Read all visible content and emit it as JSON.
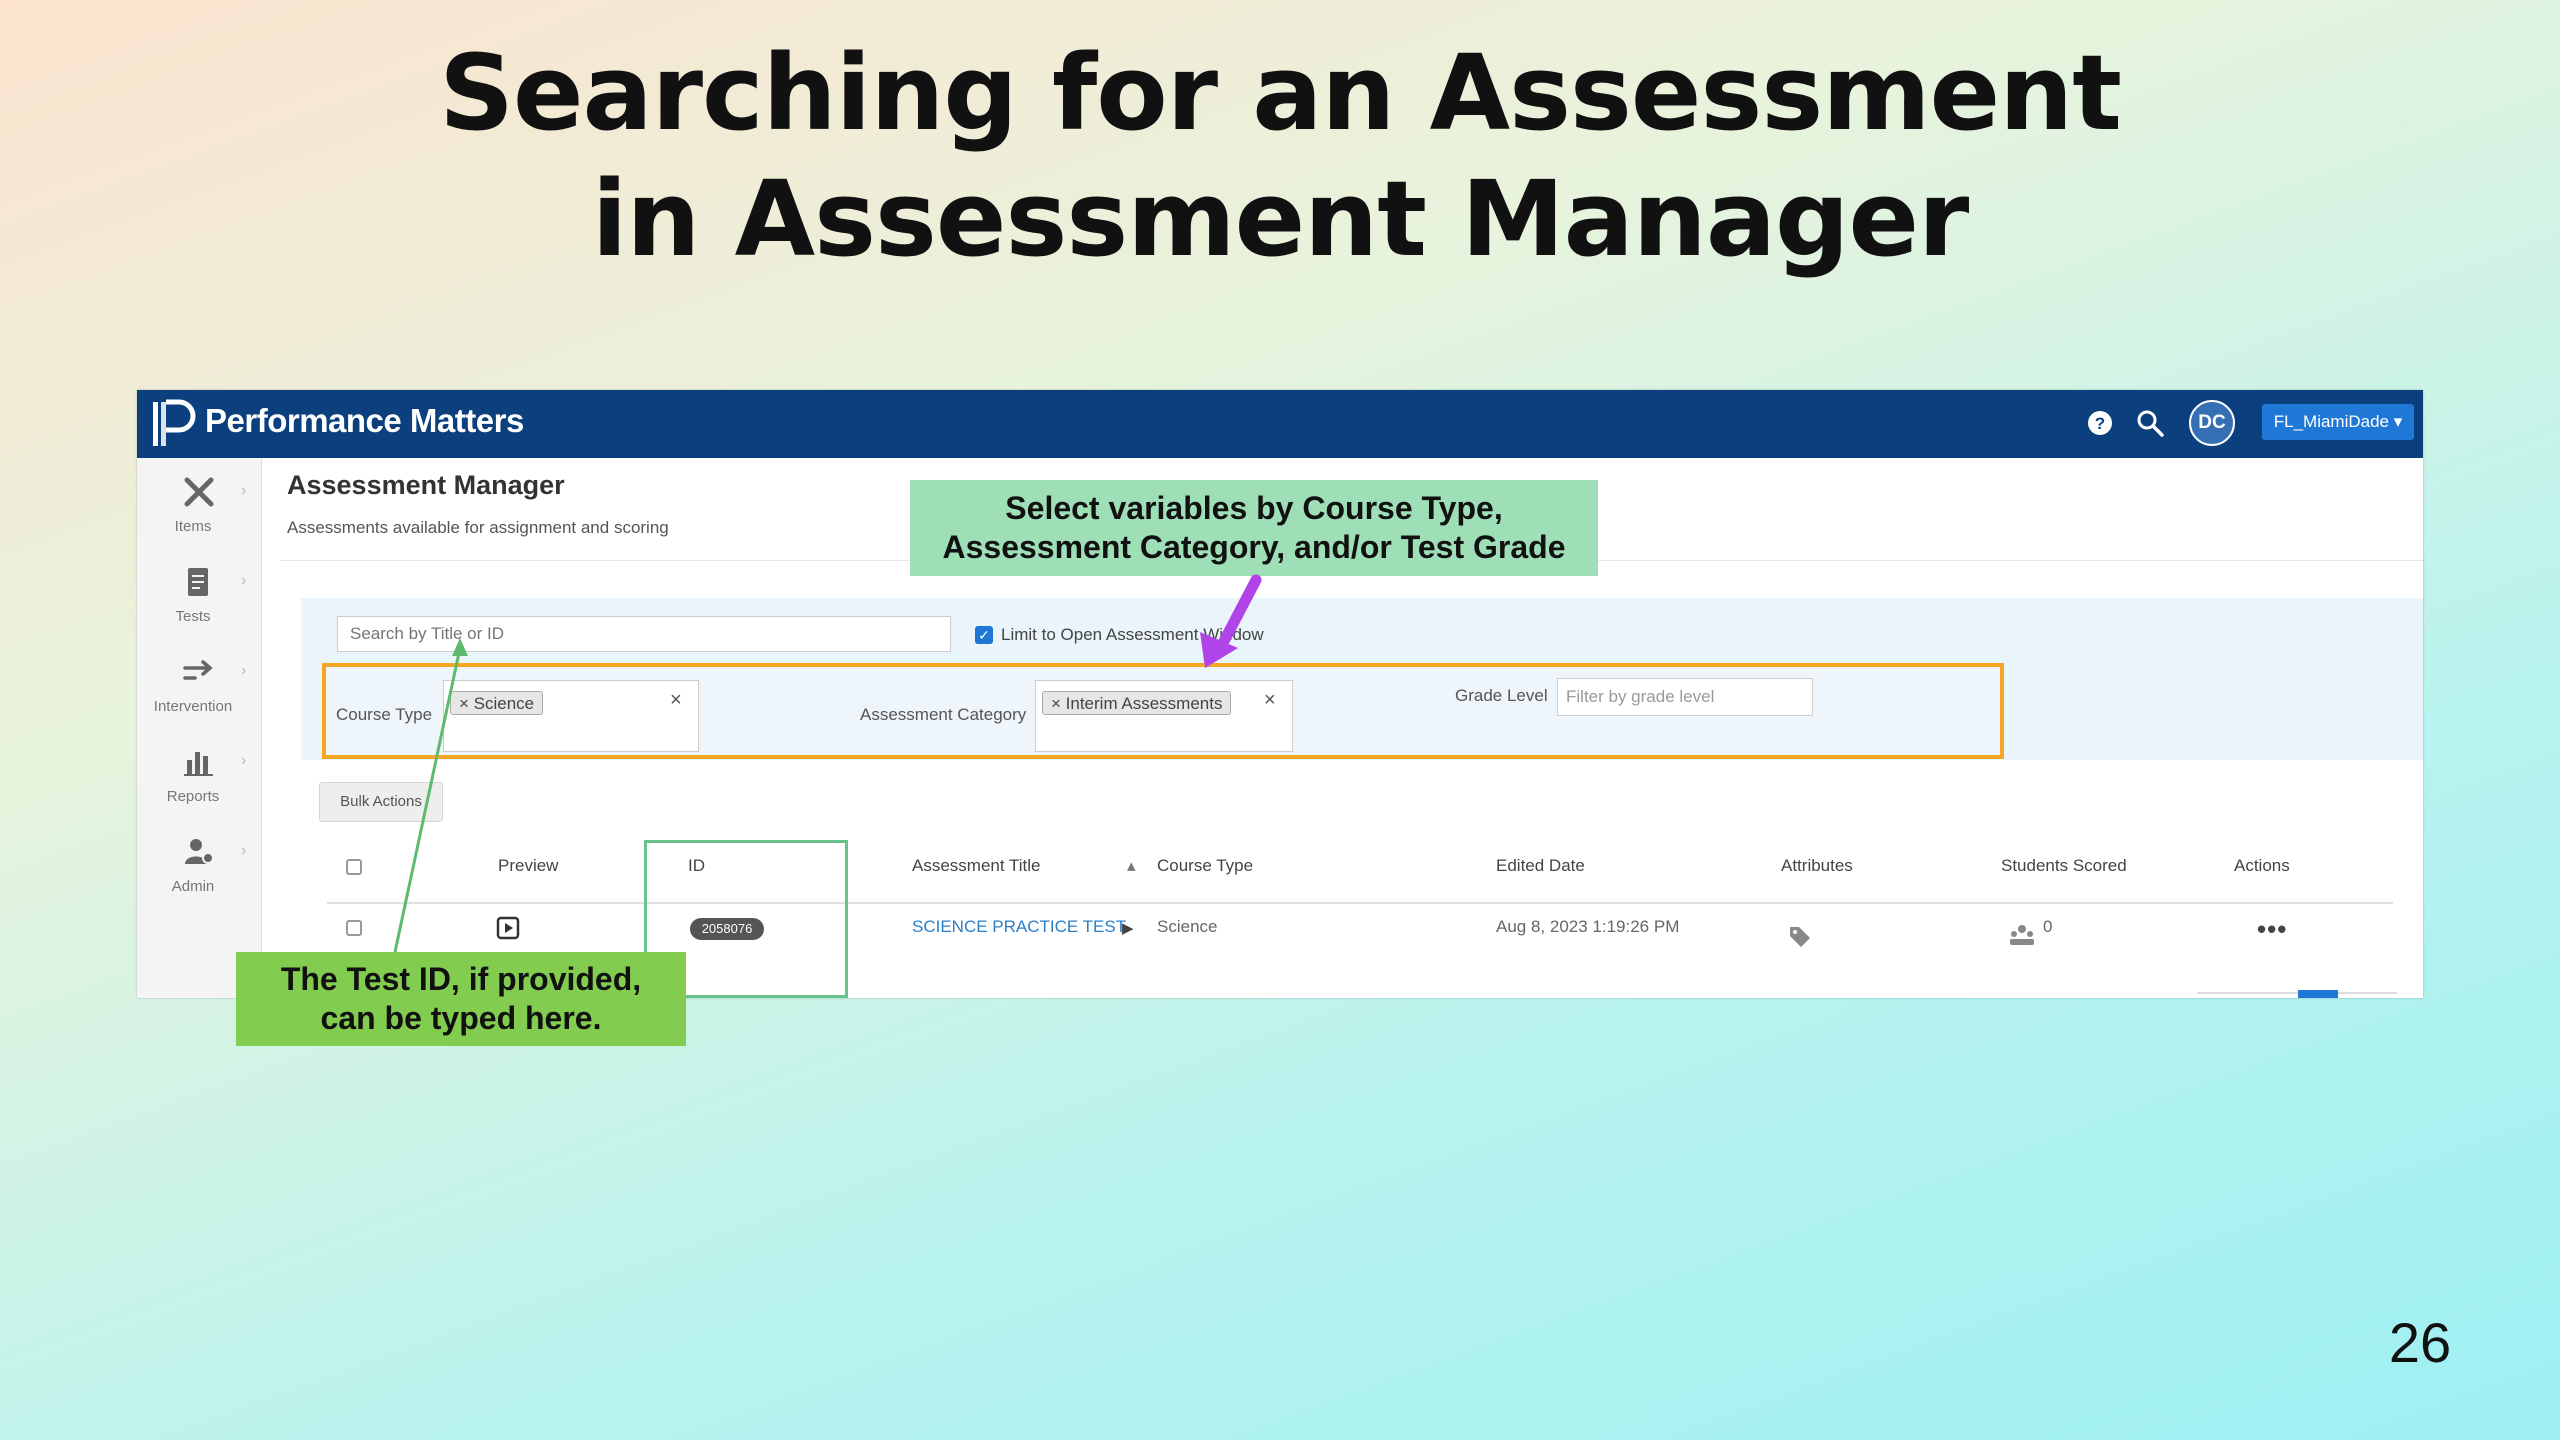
{
  "slide": {
    "title_line1": "Searching for an Assessment",
    "title_line2": "in Assessment Manager",
    "page_number": "26"
  },
  "callouts": {
    "variables_line1": "Select variables by Course Type,",
    "variables_line2": "Assessment Category, and/or Test Grade",
    "test_id_line1": "The Test ID, if provided,",
    "test_id_line2": "can be typed here."
  },
  "app": {
    "brand": "Performance Matters",
    "avatar_initials": "DC",
    "district_button": "FL_MiamiDade ▾",
    "sidebar": [
      {
        "label": "Items",
        "icon": "items-icon"
      },
      {
        "label": "Tests",
        "icon": "tests-icon"
      },
      {
        "label": "Intervention",
        "icon": "intervention-icon"
      },
      {
        "label": "Reports",
        "icon": "reports-icon"
      },
      {
        "label": "Admin",
        "icon": "admin-icon"
      }
    ],
    "page_title": "Assessment Manager",
    "page_subtitle": "Assessments available for assignment and scoring",
    "search_placeholder": "Search by Title or ID",
    "limit_label": "Limit to Open Assessment Window",
    "filters": {
      "course_type_label": "Course Type",
      "course_type_tag": "× Science",
      "category_label": "Assessment Category",
      "category_tag": "× Interim Assessments",
      "grade_label": "Grade Level",
      "grade_placeholder": "Filter by grade level",
      "clear": "×"
    },
    "bulk_actions": "Bulk Actions",
    "table": {
      "headers": {
        "preview": "Preview",
        "id": "ID",
        "title": "Assessment Title",
        "sort": "▴",
        "course_type": "Course Type",
        "edited": "Edited Date",
        "attributes": "Attributes",
        "scored": "Students Scored",
        "actions": "Actions"
      },
      "rows": [
        {
          "id": "2058076",
          "title": "SCIENCE PRACTICE TEST",
          "expand": "▶",
          "course_type": "Science",
          "edited": "Aug 8, 2023 1:19:26 PM",
          "scored": "0",
          "actions": "•••"
        }
      ]
    }
  },
  "colors": {
    "header_blue": "#0b3f7d",
    "accent_blue": "#1f78d6",
    "criteria_orange": "#f5a623",
    "callout_top_green": "#9fdfb8",
    "callout_bottom_green": "#82cc4f",
    "arrow_purple": "#b044e8"
  }
}
